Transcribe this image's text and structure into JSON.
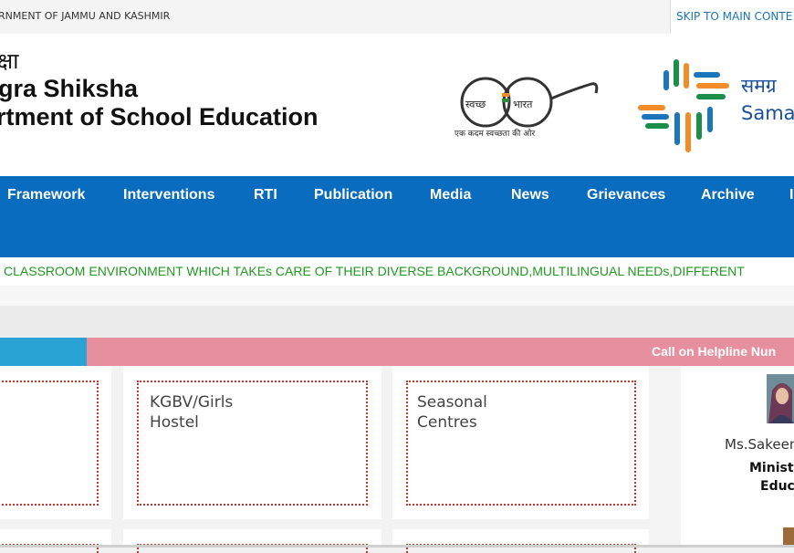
{
  "topbar": {
    "gov_text": "RNMENT OF JAMMU AND KASHMIR",
    "skip_link": "SKIP TO MAIN CONTE"
  },
  "header": {
    "hindi_title": "क्षा",
    "title_line1": "gra Shiksha",
    "title_line2": "rtment of School Education",
    "swachh_left": "स्वच्छ",
    "swachh_right": "भारत",
    "swachh_tagline": "एक कदम स्वच्छता की ओर",
    "samagra_hindi": "समग्र",
    "samagra_en": "Sama"
  },
  "nav": {
    "items": [
      "Framework",
      "Interventions",
      "RTI",
      "Publication",
      "Media",
      "News",
      "Grievances",
      "Archive",
      "I"
    ]
  },
  "marquee": {
    "text": "CLASSROOM ENVIRONMENT WHICH TAKEs CARE OF THEIR DIVERSE BACKGROUND,MULTILINGUAL NEEDs,DIFFERENT"
  },
  "helpline": {
    "text": "Call on Helpline Nun"
  },
  "cards": [
    {
      "label_line1": "",
      "label_line2": ""
    },
    {
      "label_line1": "KGBV/Girls",
      "label_line2": "Hostel"
    },
    {
      "label_line1": "Seasonal",
      "label_line2": "Centres"
    }
  ],
  "side": {
    "minister_name": "Ms.Sakeen",
    "role_line1": "Ministe",
    "role_line2": "Educ"
  },
  "colors": {
    "nav_bg": "#0a6cbf",
    "marquee_text": "#1f9a1f",
    "helpline_blue": "#2aa3d4",
    "helpline_pink": "#e68f9e",
    "card_border": "#c0392b"
  }
}
